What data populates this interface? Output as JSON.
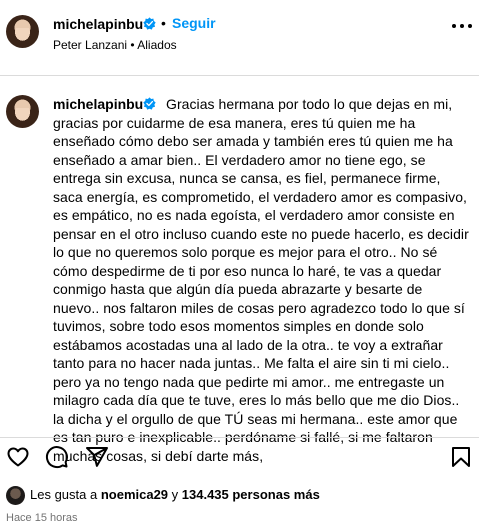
{
  "header": {
    "username": "michelapinbu",
    "separator": "•",
    "follow_label": "Seguir",
    "subtitle": "Peter Lanzani • Aliados"
  },
  "caption": {
    "username": "michelapinbu",
    "text": "Gracias hermana por todo lo que dejas en mi, gracias por cuidarme de esa manera, eres tú quien me ha enseñado cómo debo ser amada y también eres tú quien me ha enseñado a amar bien.. El verdadero amor no tiene ego, se entrega sin excusa, nunca se cansa, es fiel, permanece firme, saca energía, es comprometido, el verdadero amor es compasivo, es empático, no es nada egoísta, el verdadero amor consiste en pensar en el otro incluso cuando este no puede hacerlo, es decidir lo que no queremos solo porque es mejor para el otro.. No sé cómo despedirme de ti por eso nunca lo haré, te vas a quedar conmigo hasta que algún día pueda abrazarte y besarte de nuevo.. nos faltaron miles de cosas pero agradezco todo lo que sí tuvimos, sobre todo esos momentos simples en donde solo estábamos acostadas una al lado de la otra.. te voy a extrañar tanto para no hacer nada juntas.. Me falta el aire sin ti mi cielo.. pero ya no tengo nada que pedirte mi amor.. me entregaste un milagro cada día que te tuve, eres lo más bello que me dio Dios.. la dicha y el orgullo de que TÚ seas mi hermana.. este amor que es tan puro e inexplicable.. perdóname si fallé, si me faltaron muchas cosas, si debí darte más,"
  },
  "likes": {
    "prefix": "Les gusta a ",
    "user": "noemica29",
    "conjunction": " y ",
    "count": "134.435 personas más"
  },
  "timestamp": "Hace 15 horas",
  "colors": {
    "accent": "#0095f6",
    "verified": "#0095f6",
    "muted": "#737373",
    "divider": "#dbdbdb"
  },
  "icons": [
    "more-icon",
    "verified-badge-icon",
    "heart-icon",
    "comment-icon",
    "share-icon",
    "bookmark-icon"
  ]
}
